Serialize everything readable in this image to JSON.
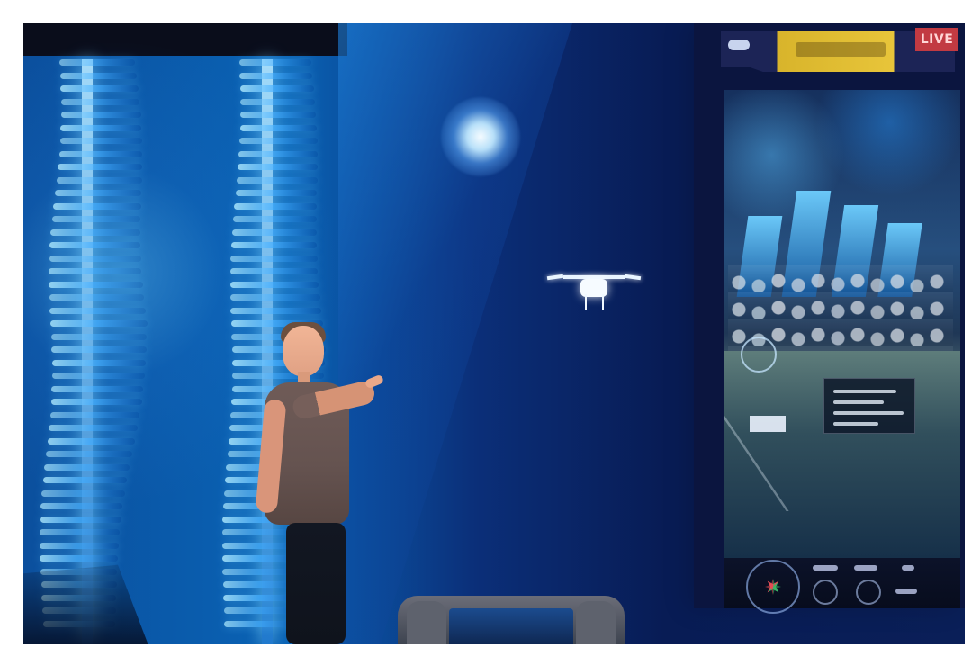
{
  "screen": {
    "live_badge": "LIVE"
  }
}
